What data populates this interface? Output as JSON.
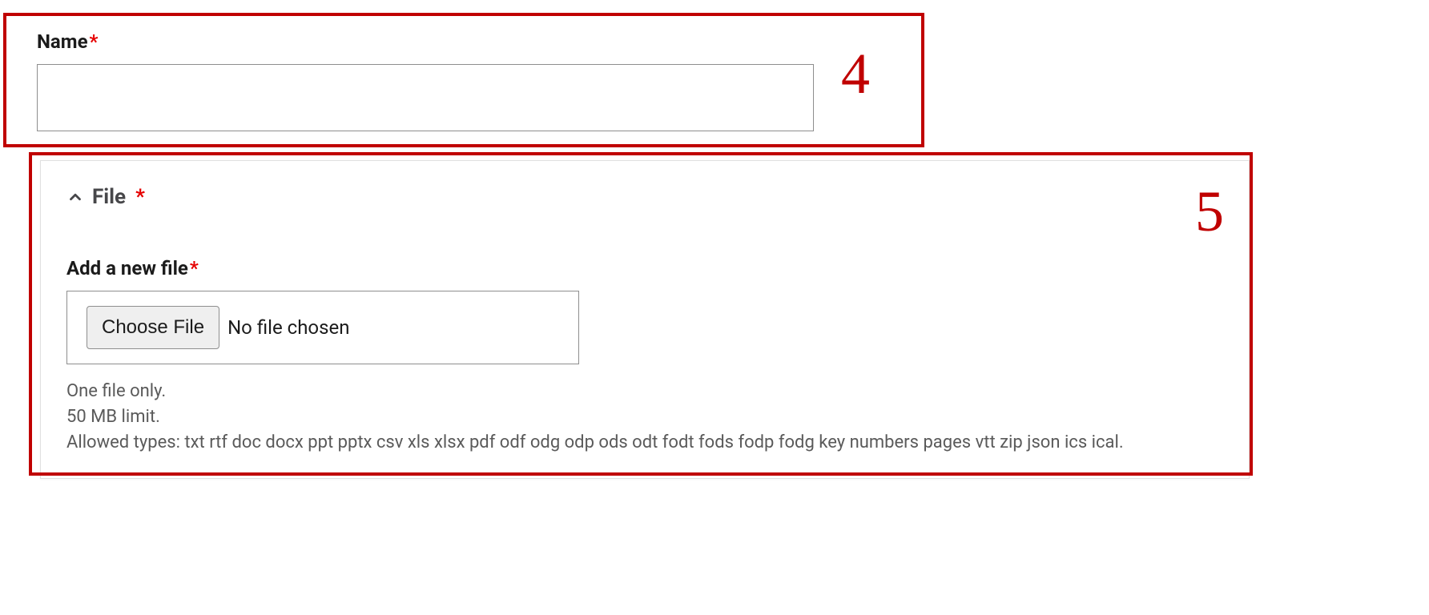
{
  "annotations": {
    "box4_number": "4",
    "box5_number": "5"
  },
  "name_field": {
    "label": "Name",
    "required_mark": "*",
    "value": ""
  },
  "file_section": {
    "legend": "File",
    "required_mark": "*",
    "add_file_label": "Add a new file",
    "choose_button": "Choose File",
    "no_file_text": "No file chosen",
    "hint_one_file": "One file only.",
    "hint_size": "50 MB limit.",
    "hint_types": "Allowed types: txt rtf doc docx ppt pptx csv xls xlsx pdf odf odg odp ods odt fodt fods fodp fodg key numbers pages vtt zip json ics ical."
  }
}
